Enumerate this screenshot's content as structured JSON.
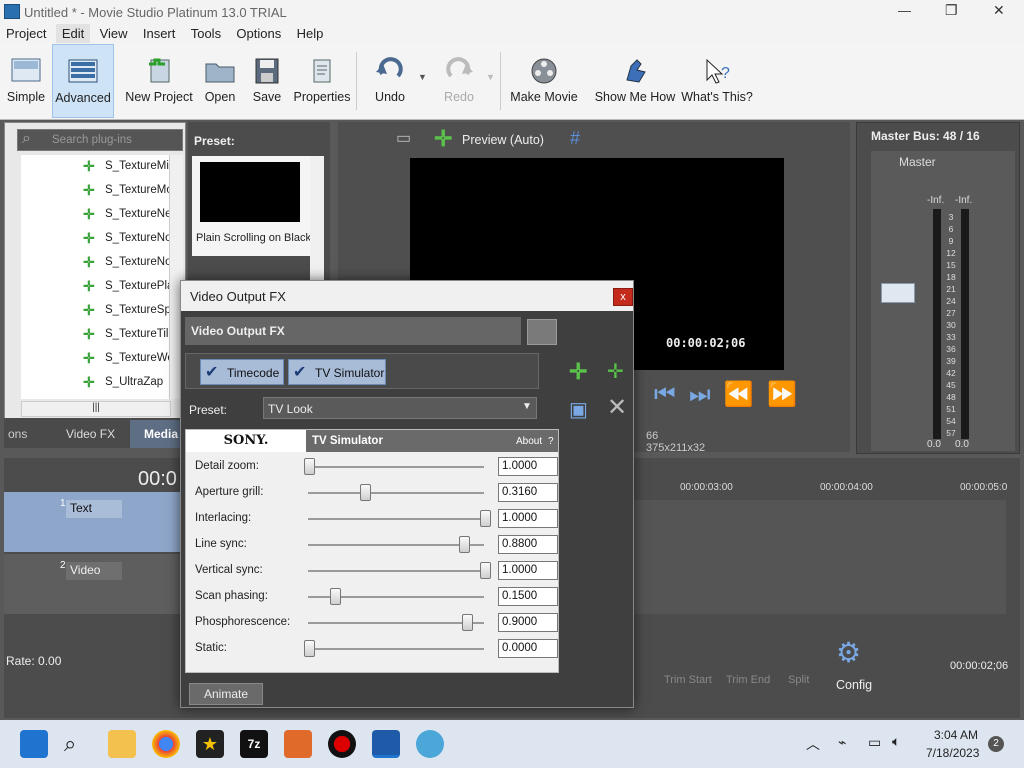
{
  "window": {
    "title": "Untitled * - Movie Studio Platinum 13.0 TRIAL",
    "minimize": "—",
    "maximize": "❐",
    "close": "✕"
  },
  "menu": [
    "Project",
    "Edit",
    "View",
    "Insert",
    "Tools",
    "Options",
    "Help"
  ],
  "toolbar": {
    "simple": "Simple",
    "advanced": "Advanced",
    "new_project": "New Project",
    "open": "Open",
    "save": "Save",
    "properties": "Properties",
    "undo": "Undo",
    "redo": "Redo",
    "make_movie": "Make Movie",
    "show_me_how": "Show Me How",
    "whats_this": "What's This?"
  },
  "plugins": {
    "search_placeholder": "Search plug-ins",
    "items": [
      "S_TextureMi",
      "S_TextureMo",
      "S_TextureNe",
      "S_TextureNo",
      "S_TextureNo",
      "S_TexturePla",
      "S_TextureSp",
      "S_TextureTil",
      "S_TextureWe",
      "S_UltraZap"
    ],
    "tabs": [
      "ons",
      "Video FX",
      "Media"
    ]
  },
  "preset_panel": {
    "label": "Preset:",
    "thumb_caption": "Plain Scrolling on Black"
  },
  "preview": {
    "mode": "Preview (Auto)",
    "timecode": "00:00:02;06",
    "frame": "66",
    "size": "375x211x32"
  },
  "master": {
    "title": "Master Bus: 48 / 16",
    "label": "Master",
    "inf_left": "-Inf.",
    "inf_right": "-Inf.",
    "scale": [
      "3",
      "6",
      "9",
      "12",
      "15",
      "18",
      "21",
      "24",
      "27",
      "30",
      "33",
      "36",
      "39",
      "42",
      "45",
      "48",
      "51",
      "54",
      "57"
    ],
    "zero_left": "0.0",
    "zero_right": "0.0"
  },
  "timeline": {
    "time": "00:0",
    "ruler": [
      "00:00:03:00",
      "00:00:04:00",
      "00:00:05:0"
    ],
    "tracks": [
      {
        "num": "1",
        "name": "Text"
      },
      {
        "num": "2",
        "name": "Video"
      }
    ],
    "rate": "Rate: 0.00",
    "end_timecode": "00:00:02;06",
    "buttons": [
      "Trim Start",
      "Trim End",
      "Split"
    ],
    "config": "Config"
  },
  "dialog": {
    "title": "Video Output FX",
    "close": "x",
    "header": "Video Output FX",
    "chain": [
      "Timecode",
      "TV Simulator"
    ],
    "preset_label": "Preset:",
    "preset_value": "TV Look",
    "brand": "SONY.",
    "plugin_name": "TV Simulator",
    "about": "About",
    "about_q": "?",
    "params": [
      {
        "label": "Detail zoom:",
        "value": "1.0000",
        "level": 0.0
      },
      {
        "label": "Aperture grill:",
        "value": "0.3160",
        "level": 0.32
      },
      {
        "label": "Interlacing:",
        "value": "1.0000",
        "level": 1.0
      },
      {
        "label": "Line sync:",
        "value": "0.8800",
        "level": 0.88
      },
      {
        "label": "Vertical sync:",
        "value": "1.0000",
        "level": 1.0
      },
      {
        "label": "Scan phasing:",
        "value": "0.1500",
        "level": 0.15
      },
      {
        "label": "Phosphorescence:",
        "value": "0.9000",
        "level": 0.9
      },
      {
        "label": "Static:",
        "value": "0.0000",
        "level": 0.0
      }
    ],
    "animate": "Animate"
  },
  "clock": {
    "time": "3:04 AM",
    "date": "7/18/2023",
    "notifications": "2"
  }
}
